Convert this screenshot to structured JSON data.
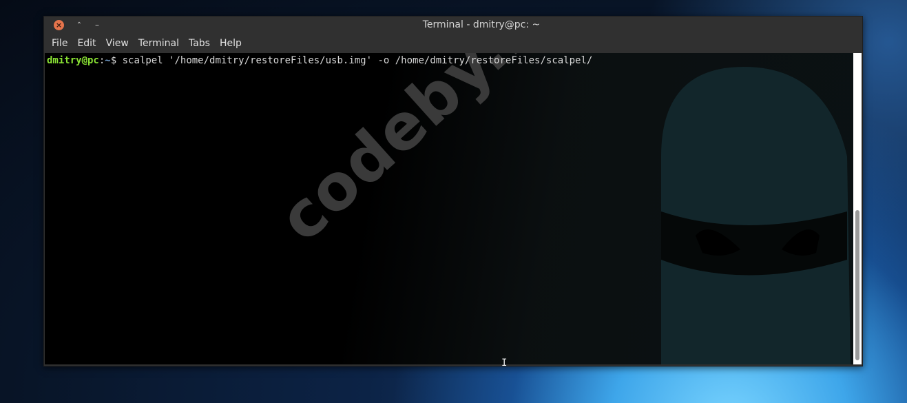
{
  "window": {
    "title": "Terminal - dmitry@pc: ~",
    "controls": {
      "close_icon": "×",
      "maximize_icon": "⌃",
      "minimize_icon": "–"
    }
  },
  "menubar": {
    "items": [
      "File",
      "Edit",
      "View",
      "Terminal",
      "Tabs",
      "Help"
    ]
  },
  "terminal": {
    "prompt_user": "dmitry@pc",
    "prompt_sep": ":",
    "prompt_path": "~",
    "prompt_symbol": "$",
    "command": " scalpel '/home/dmitry/restoreFiles/usb.img' -o /home/dmitry/restoreFiles/scalpel/"
  },
  "watermark": "codeby.net",
  "cursor_glyph": "I",
  "colors": {
    "prompt_user": "#8ae234",
    "prompt_path": "#729fcf",
    "close_button": "#e5744c"
  }
}
